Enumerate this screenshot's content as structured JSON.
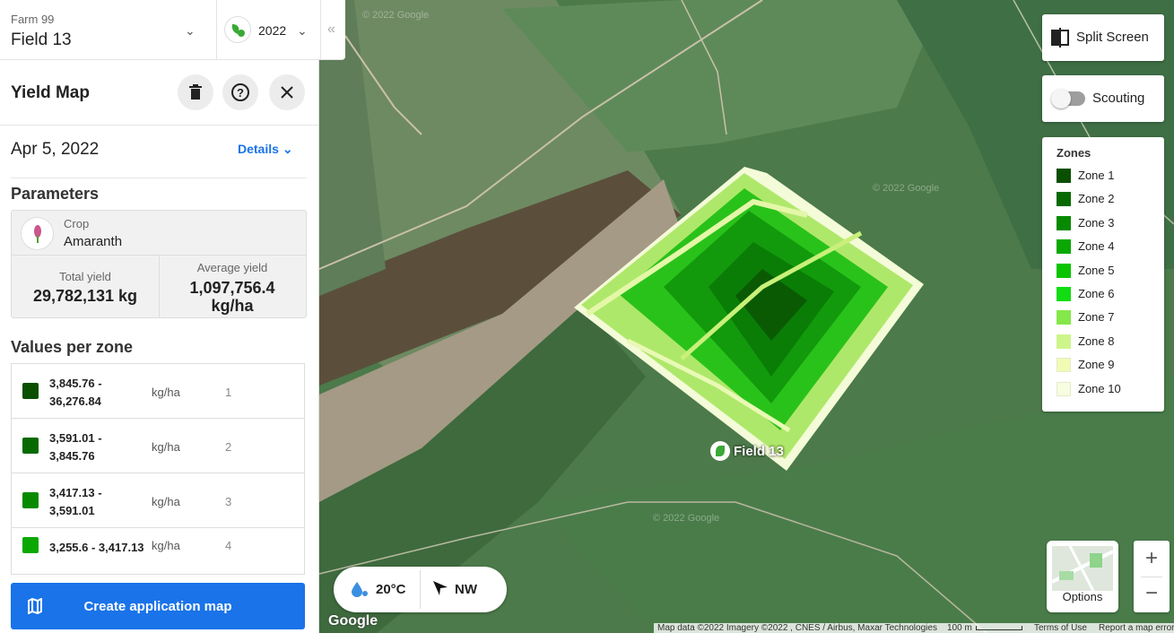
{
  "header": {
    "farm": "Farm 99",
    "field": "Field 13",
    "season": "2022"
  },
  "panel": {
    "title": "Yield Map",
    "date": "Apr 5, 2022",
    "details_label": "Details",
    "parameters_title": "Parameters",
    "crop_label": "Crop",
    "crop_value": "Amaranth",
    "total_yield_label": "Total yield",
    "total_yield_value": "29,782,131 kg",
    "avg_yield_label": "Average yield",
    "avg_yield_value": "1,097,756.4",
    "avg_yield_unit": "kg/ha",
    "values_title": "Values per zone",
    "zones": [
      {
        "range_a": "3,845.76 -",
        "range_b": "36,276.84",
        "unit": "kg/ha",
        "num": "1",
        "color": "#0a4f00"
      },
      {
        "range_a": "3,591.01 -",
        "range_b": "3,845.76",
        "unit": "kg/ha",
        "num": "2",
        "color": "#066a00"
      },
      {
        "range_a": "3,417.13 -",
        "range_b": "3,591.01",
        "unit": "kg/ha",
        "num": "3",
        "color": "#088a00"
      },
      {
        "range_a": "3,255.6 - 3,417.13",
        "range_b": "",
        "unit": "kg/ha",
        "num": "4",
        "color": "#0aa800"
      }
    ],
    "cta_label": "Create application map"
  },
  "map": {
    "split_screen_label": "Split Screen",
    "scouting_label": "Scouting",
    "zones_title": "Zones",
    "legend": [
      {
        "label": "Zone 1",
        "color": "#0a4f00"
      },
      {
        "label": "Zone 2",
        "color": "#066a00"
      },
      {
        "label": "Zone 3",
        "color": "#088a00"
      },
      {
        "label": "Zone 4",
        "color": "#0aa800"
      },
      {
        "label": "Zone 5",
        "color": "#0ac400"
      },
      {
        "label": "Zone 6",
        "color": "#12dc12"
      },
      {
        "label": "Zone 7",
        "color": "#84e84a"
      },
      {
        "label": "Zone 8",
        "color": "#cdf58a"
      },
      {
        "label": "Zone 9",
        "color": "#f1fbb4"
      },
      {
        "label": "Zone 10",
        "color": "#f7fde0"
      }
    ],
    "field_label": "Field 13",
    "temperature": "20°C",
    "wind": "NW",
    "options_label": "Options",
    "google": "Google",
    "watermark": "© 2022 Google",
    "attribution": "Map data ©2022 Imagery ©2022 , CNES / Airbus, Maxar Technologies",
    "scale": "100 m",
    "terms": "Terms of Use",
    "report": "Report a map error"
  }
}
